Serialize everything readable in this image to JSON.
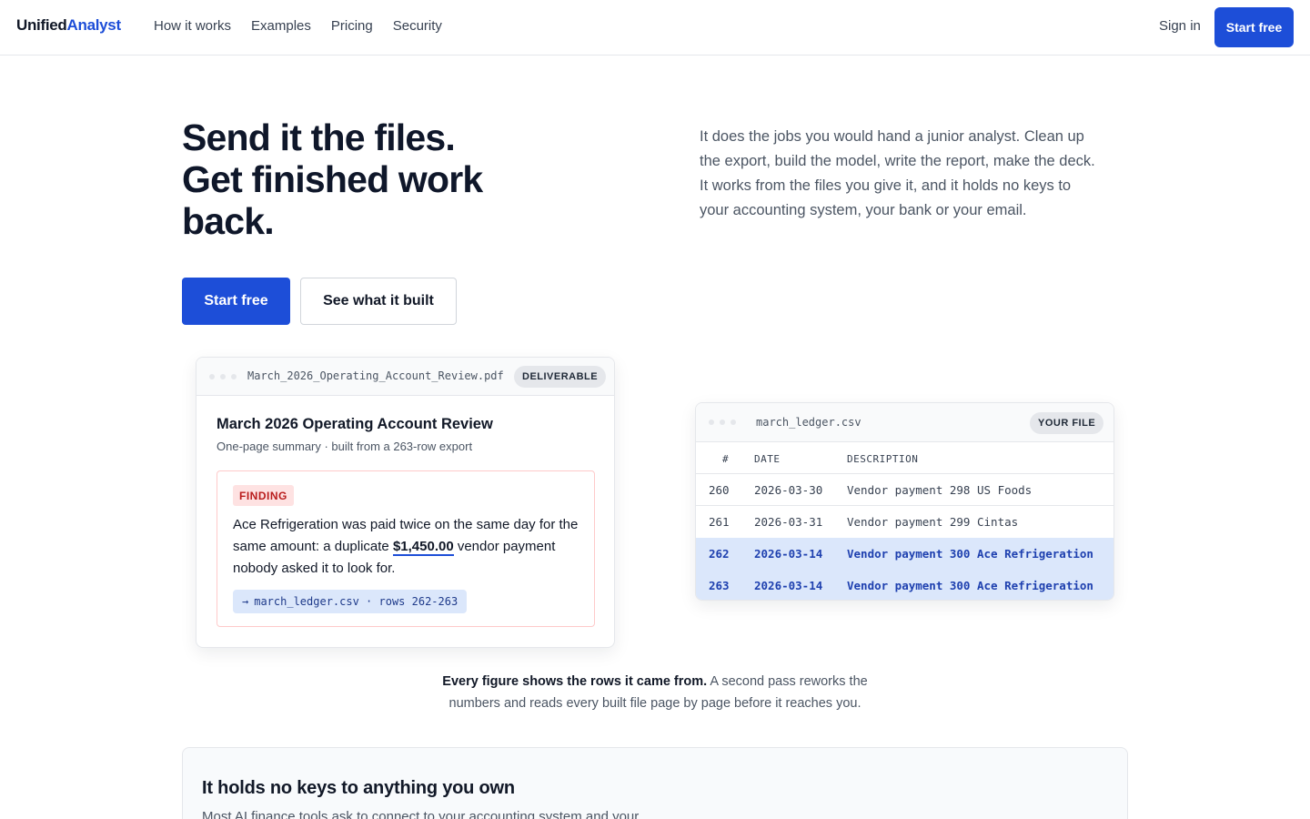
{
  "header": {
    "logo_part1": "Unified",
    "logo_part2": "Analyst",
    "nav": [
      "How it works",
      "Examples",
      "Pricing",
      "Security"
    ],
    "signin": "Sign in",
    "cta": "Start free"
  },
  "hero": {
    "title_line1": "Send it the files.",
    "title_line2": "Get finished work back.",
    "lead": "It does the jobs you would hand a junior analyst. Clean up the export, build the model, write the report, make the deck. It works from the files you give it, and it holds no keys to your accounting system, your bank or your email.",
    "cta_primary": "Start free",
    "cta_secondary": "See what it built"
  },
  "deliverable": {
    "filename": "March_2026_Operating_Account_Review.pdf",
    "badge": "DELIVERABLE",
    "title": "March 2026 Operating Account Review",
    "subtitle": "One-page summary · built from a 263-row export",
    "finding_tag": "FINDING",
    "finding_text_1": "Ace Refrigeration was paid twice on the same day for the same amount: a duplicate ",
    "finding_amount": "$1,450.00",
    "finding_text_2": " vendor payment nobody asked it to look for.",
    "source_arrow": "→",
    "source": "march_ledger.csv · rows 262-263"
  },
  "ledger": {
    "filename": "march_ledger.csv",
    "badge": "YOUR FILE",
    "columns": [
      "#",
      "DATE",
      "DESCRIPTION"
    ],
    "rows": [
      {
        "num": "260",
        "date": "2026-03-30",
        "desc": "Vendor payment 298 US Foods"
      },
      {
        "num": "261",
        "date": "2026-03-31",
        "desc": "Vendor payment 299 Cintas"
      },
      {
        "num": "262",
        "date": "2026-03-14",
        "desc": "Vendor payment 300 Ace Refrigeration"
      },
      {
        "num": "263",
        "date": "2026-03-14",
        "desc": "Vendor payment 300 Ace Refrigeration"
      }
    ]
  },
  "caption": {
    "bold": "Every figure shows the rows it came from.",
    "rest": " A second pass reworks the numbers and reads every built file page by page before it reaches you."
  },
  "panel": {
    "title": "It holds no keys to anything you own",
    "body": "Most AI finance tools ask to connect to your accounting system and your"
  }
}
